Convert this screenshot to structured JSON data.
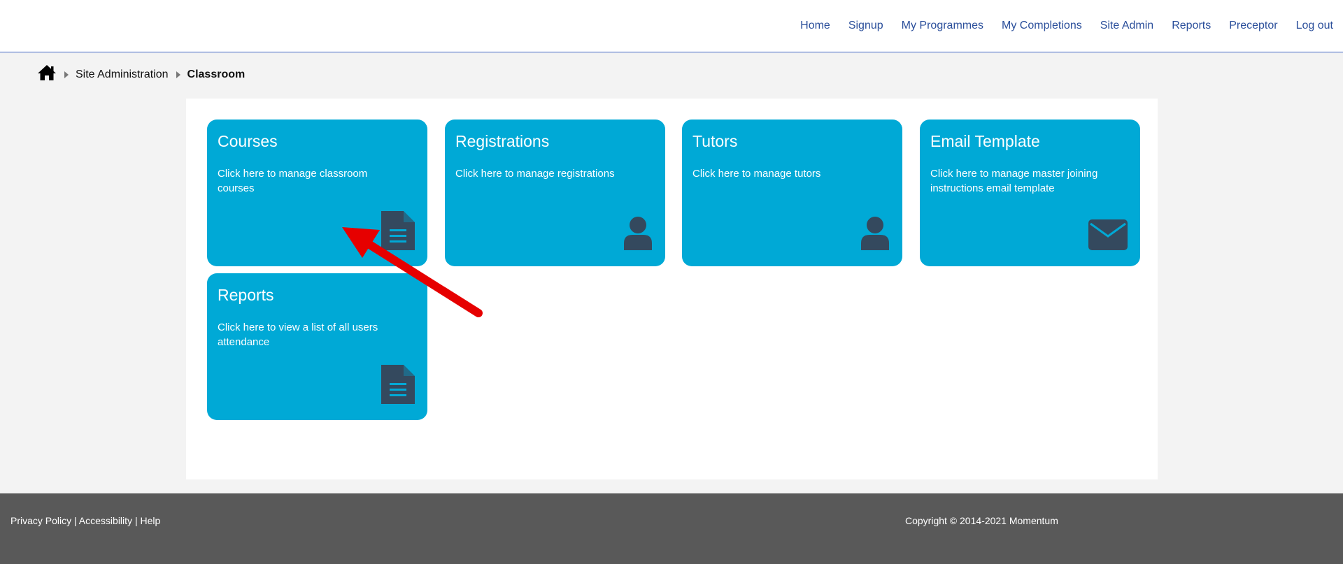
{
  "nav": {
    "items": [
      "Home",
      "Signup",
      "My Programmes",
      "My Completions",
      "Site Admin",
      "Reports",
      "Preceptor",
      "Log out"
    ]
  },
  "breadcrumb": {
    "icon": "home-icon",
    "items": [
      "Site Administration",
      "Classroom"
    ]
  },
  "tiles": [
    {
      "title": "Courses",
      "desc": "Click here to manage classroom courses",
      "icon": "document-icon"
    },
    {
      "title": "Registrations",
      "desc": "Click here to manage registrations",
      "icon": "user-icon"
    },
    {
      "title": "Tutors",
      "desc": "Click here to manage tutors",
      "icon": "user-icon"
    },
    {
      "title": "Email Template",
      "desc": "Click here to manage master joining instructions email template",
      "icon": "envelope-icon"
    },
    {
      "title": "Reports",
      "desc": "Click here to view a list of all users attendance",
      "icon": "document-icon"
    }
  ],
  "footer": {
    "links": [
      "Privacy Policy",
      "Accessibility",
      "Help"
    ],
    "separator": "|",
    "copyright": "Copyright © 2014-2021 Momentum"
  },
  "colors": {
    "tile": "#00a9d6",
    "icon": "#34495e",
    "nav_link": "#2b4f9b",
    "footer": "#595959",
    "annotation_arrow": "#e60000"
  }
}
